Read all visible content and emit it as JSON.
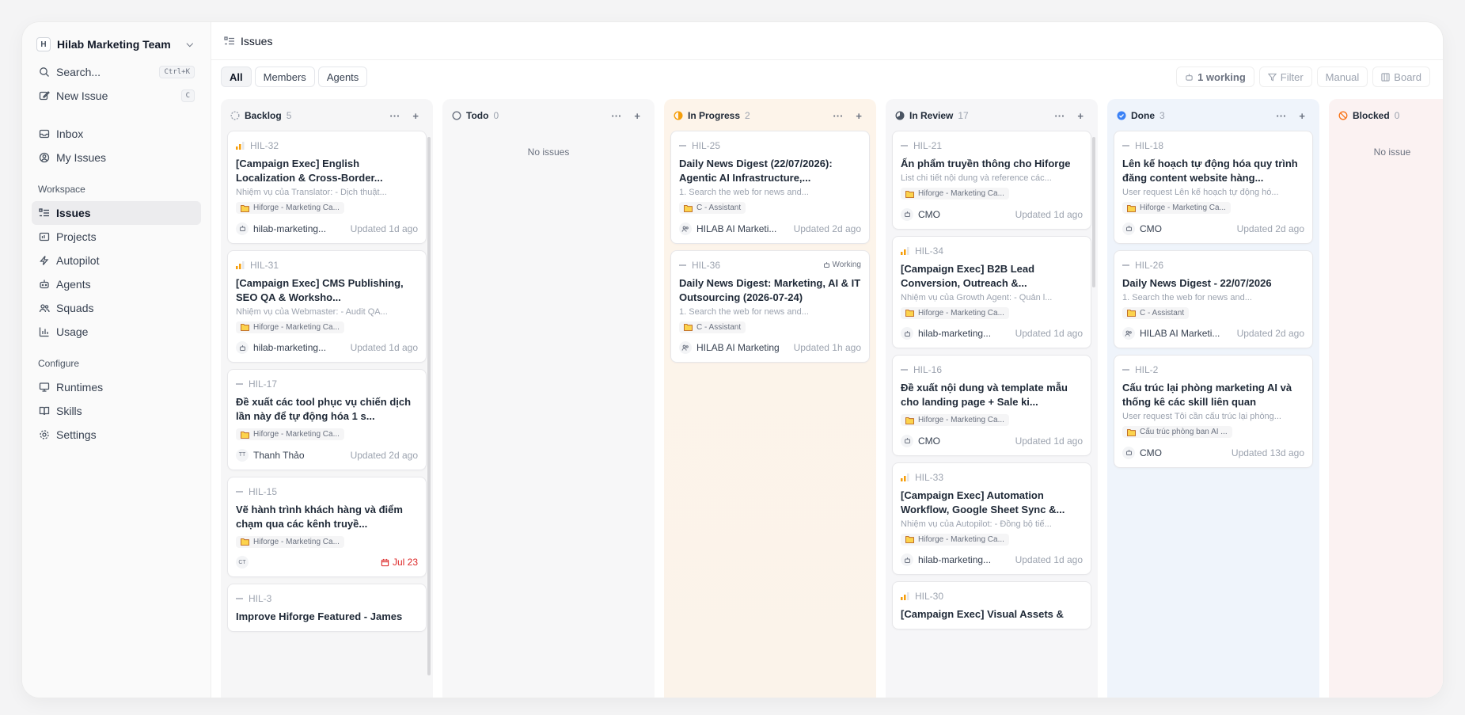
{
  "sidebar": {
    "team": {
      "badge": "H",
      "name": "Hilab Marketing Team"
    },
    "top_items": [
      {
        "label": "Search...",
        "kbd": "Ctrl+K",
        "icon": "search-icon"
      },
      {
        "label": "New Issue",
        "kbd": "C",
        "icon": "edit-icon"
      }
    ],
    "personal_items": [
      {
        "label": "Inbox",
        "icon": "inbox-icon"
      },
      {
        "label": "My Issues",
        "icon": "user-circle-icon"
      }
    ],
    "workspace_label": "Workspace",
    "workspace_items": [
      {
        "label": "Issues",
        "icon": "list-icon",
        "active": true
      },
      {
        "label": "Projects",
        "icon": "folder-icon"
      },
      {
        "label": "Autopilot",
        "icon": "bolt-icon"
      },
      {
        "label": "Agents",
        "icon": "bot-icon"
      },
      {
        "label": "Squads",
        "icon": "users-icon"
      },
      {
        "label": "Usage",
        "icon": "chart-icon"
      }
    ],
    "configure_label": "Configure",
    "configure_items": [
      {
        "label": "Runtimes",
        "icon": "monitor-icon"
      },
      {
        "label": "Skills",
        "icon": "book-icon"
      },
      {
        "label": "Settings",
        "icon": "gear-icon"
      }
    ]
  },
  "header": {
    "title": "Issues"
  },
  "toolbar": {
    "filters": [
      {
        "label": "All",
        "active": true
      },
      {
        "label": "Members",
        "active": false
      },
      {
        "label": "Agents",
        "active": false
      }
    ],
    "working": "1 working",
    "filter": "Filter",
    "manual": "Manual",
    "board": "Board"
  },
  "columns": [
    {
      "key": "backlog",
      "name": "Backlog",
      "count": "5",
      "no_issues": "",
      "cards": [
        {
          "id": "HIL-32",
          "priority": "medium",
          "title": "[Campaign Exec] English Localization & Cross-Border...",
          "desc": "Nhiệm vụ của Translator: - Dịch thuật...",
          "project": "Hiforge - Marketing Ca...",
          "avatar": "bot",
          "assignee": "hilab-marketing...",
          "updated": "Updated 1d ago"
        },
        {
          "id": "HIL-31",
          "priority": "medium",
          "title": "[Campaign Exec] CMS Publishing, SEO QA & Worksho...",
          "desc": "Nhiệm vụ của Webmaster: - Audit QA...",
          "project": "Hiforge - Marketing Ca...",
          "avatar": "bot",
          "assignee": "hilab-marketing...",
          "updated": "Updated 1d ago"
        },
        {
          "id": "HIL-17",
          "priority": "none",
          "title": "Đề xuất các tool phục vụ chiến dịch lần này để tự động hóa 1 s...",
          "desc": "",
          "project": "Hiforge - Marketing Ca...",
          "avatar": "TT",
          "assignee": "Thanh Thảo",
          "updated": "Updated 2d ago"
        },
        {
          "id": "HIL-15",
          "priority": "none",
          "title": "Vẽ hành trình khách hàng và điểm chạm qua các kênh truyề...",
          "desc": "",
          "project": "Hiforge - Marketing Ca...",
          "avatar": "CT",
          "assignee": "",
          "due": "Jul 23"
        },
        {
          "id": "HIL-3",
          "priority": "none",
          "title": "Improve Hiforge Featured - James",
          "desc": "",
          "project": "",
          "avatar": "",
          "assignee": "",
          "updated": ""
        }
      ]
    },
    {
      "key": "todo",
      "name": "Todo",
      "count": "0",
      "no_issues": "No issues",
      "cards": []
    },
    {
      "key": "inprogress",
      "name": "In Progress",
      "count": "2",
      "no_issues": "",
      "cards": [
        {
          "id": "HIL-25",
          "priority": "none",
          "title": "Daily News Digest (22/07/2026): Agentic AI Infrastructure,...",
          "desc": "1. Search the web for news and...",
          "project": "C - Assistant",
          "avatar": "users",
          "assignee": "HILAB AI Marketi...",
          "updated": "Updated 2d ago"
        },
        {
          "id": "HIL-36",
          "priority": "none",
          "status_tag": "Working",
          "title": "Daily News Digest: Marketing, AI & IT Outsourcing (2026-07-24)",
          "desc": "1. Search the web for news and...",
          "project": "C - Assistant",
          "avatar": "users",
          "assignee": "HILAB AI Marketing",
          "updated": "Updated 1h ago"
        }
      ]
    },
    {
      "key": "inreview",
      "name": "In Review",
      "count": "17",
      "no_issues": "",
      "cards": [
        {
          "id": "HIL-21",
          "priority": "none",
          "title": "Ấn phẩm truyền thông cho Hiforge",
          "desc": "List chi tiết nội dung và reference các...",
          "project": "Hiforge - Marketing Ca...",
          "avatar": "bot",
          "assignee": "CMO",
          "updated": "Updated 1d ago"
        },
        {
          "id": "HIL-34",
          "priority": "medium",
          "title": "[Campaign Exec] B2B Lead Conversion, Outreach &...",
          "desc": "Nhiệm vụ của Growth Agent: - Quản l...",
          "project": "Hiforge - Marketing Ca...",
          "avatar": "bot",
          "assignee": "hilab-marketing...",
          "updated": "Updated 1d ago"
        },
        {
          "id": "HIL-16",
          "priority": "none",
          "title": "Đề xuất nội dung và template mẫu cho landing page + Sale ki...",
          "desc": "",
          "project": "Hiforge - Marketing Ca...",
          "avatar": "bot",
          "assignee": "CMO",
          "updated": "Updated 1d ago"
        },
        {
          "id": "HIL-33",
          "priority": "medium",
          "title": "[Campaign Exec] Automation Workflow, Google Sheet Sync &...",
          "desc": "Nhiệm vụ của Autopilot: - Đồng bộ tiế...",
          "project": "Hiforge - Marketing Ca...",
          "avatar": "bot",
          "assignee": "hilab-marketing...",
          "updated": "Updated 1d ago"
        },
        {
          "id": "HIL-30",
          "priority": "medium",
          "title": "[Campaign Exec] Visual Assets &",
          "desc": "",
          "project": "",
          "avatar": "",
          "assignee": "",
          "updated": ""
        }
      ]
    },
    {
      "key": "done",
      "name": "Done",
      "count": "3",
      "no_issues": "",
      "cards": [
        {
          "id": "HIL-18",
          "priority": "none",
          "title": "Lên kế hoạch tự động hóa quy trình đăng content website hàng...",
          "desc": "User request Lên kế hoạch tự động hó...",
          "project": "Hiforge - Marketing Ca...",
          "avatar": "bot",
          "assignee": "CMO",
          "updated": "Updated 2d ago"
        },
        {
          "id": "HIL-26",
          "priority": "none",
          "title": "Daily News Digest - 22/07/2026",
          "desc": "1. Search the web for news and...",
          "project": "C - Assistant",
          "avatar": "users",
          "assignee": "HILAB AI Marketi...",
          "updated": "Updated 2d ago"
        },
        {
          "id": "HIL-2",
          "priority": "none",
          "title": "Cấu trúc lại phòng marketing AI và thống kê các skill liên quan",
          "desc": "User request Tôi cần cấu trúc lại phòng...",
          "project": "Cấu trúc phòng ban AI ...",
          "avatar": "bot",
          "assignee": "CMO",
          "updated": "Updated 13d ago"
        }
      ]
    },
    {
      "key": "blocked",
      "name": "Blocked",
      "count": "0",
      "no_issues": "No issue",
      "cards": []
    }
  ],
  "colors": {
    "backlog": "#9ca3af",
    "todo": "#6b7280",
    "inprogress": "#f59e0b",
    "inreview": "#4b5563",
    "done": "#3b82f6",
    "blocked": "#f97316",
    "priority": "#f59e0b",
    "due": "#dc2626"
  }
}
